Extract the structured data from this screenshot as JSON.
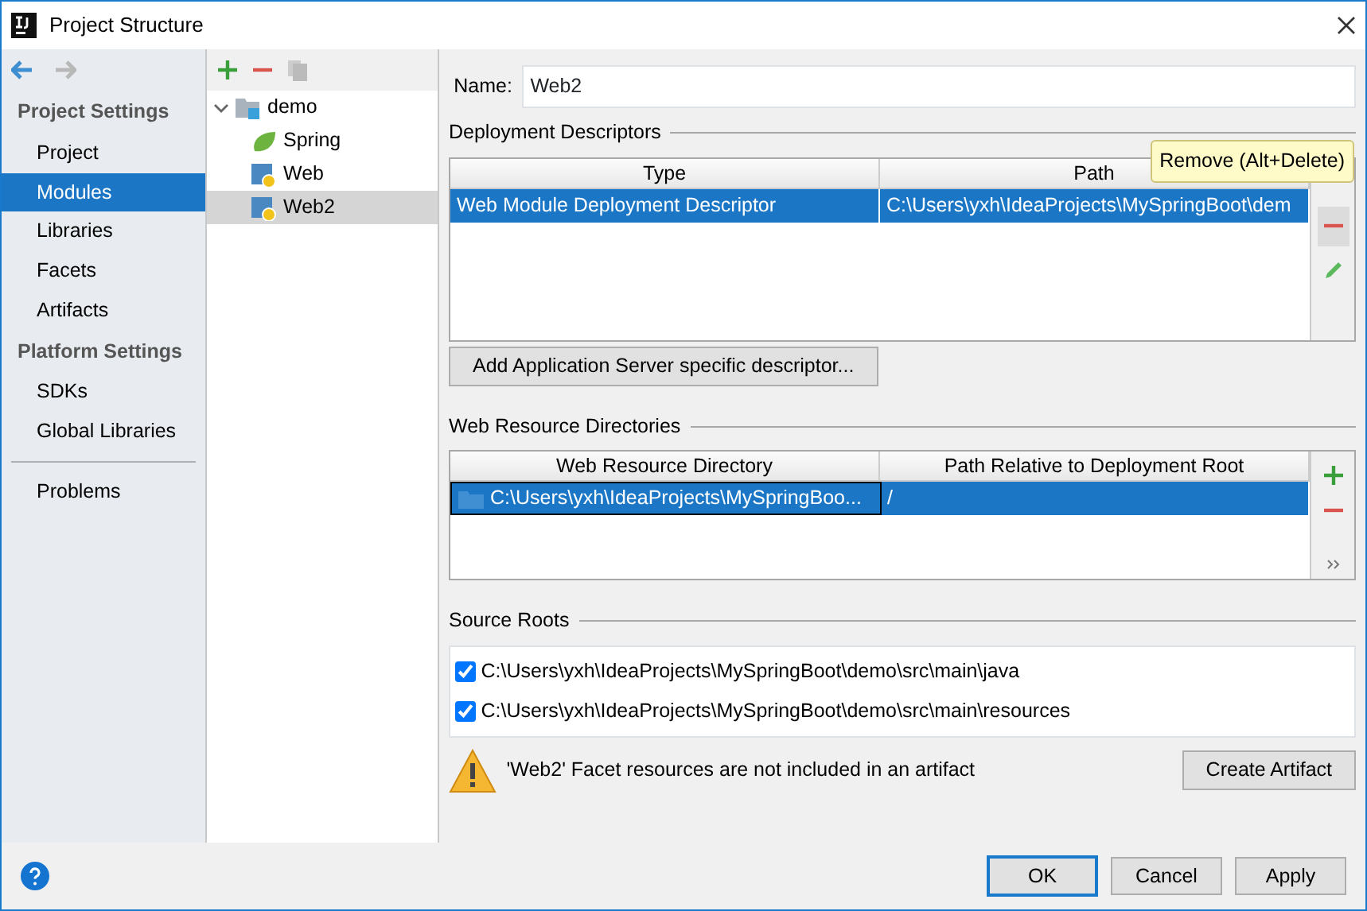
{
  "window": {
    "title": "Project Structure"
  },
  "sidebar": {
    "sections": [
      {
        "heading": "Project Settings",
        "items": [
          {
            "label": "Project",
            "selected": false
          },
          {
            "label": "Modules",
            "selected": true
          },
          {
            "label": "Libraries",
            "selected": false
          },
          {
            "label": "Facets",
            "selected": false
          },
          {
            "label": "Artifacts",
            "selected": false
          }
        ]
      },
      {
        "heading": "Platform Settings",
        "items": [
          {
            "label": "SDKs",
            "selected": false
          },
          {
            "label": "Global Libraries",
            "selected": false
          }
        ]
      }
    ],
    "bottom_items": [
      {
        "label": "Problems",
        "selected": false
      }
    ]
  },
  "tree": [
    {
      "label": "demo",
      "kind": "module",
      "expanded": true,
      "selected": false,
      "children": [
        {
          "label": "Spring",
          "kind": "spring",
          "selected": false
        },
        {
          "label": "Web",
          "kind": "web",
          "selected": false
        },
        {
          "label": "Web2",
          "kind": "web",
          "selected": true
        }
      ]
    }
  ],
  "name_field": {
    "label": "Name:",
    "value": "Web2"
  },
  "deployment_descriptors": {
    "title": "Deployment Descriptors",
    "columns": [
      "Type",
      "Path"
    ],
    "rows": [
      {
        "cells": [
          "Web Module Deployment Descriptor",
          "C:\\Users\\yxh\\IdeaProjects\\MySpringBoot\\dem"
        ],
        "selected": true
      }
    ],
    "tooltip": "Remove (Alt+Delete)",
    "add_button": "Add Application Server specific descriptor..."
  },
  "web_resource_directories": {
    "title": "Web Resource Directories",
    "columns": [
      "Web Resource Directory",
      "Path Relative to Deployment Root"
    ],
    "rows": [
      {
        "cells": [
          "C:\\Users\\yxh\\IdeaProjects\\MySpringBoo...",
          "/"
        ],
        "selected": true
      }
    ]
  },
  "source_roots": {
    "title": "Source Roots",
    "items": [
      {
        "label": "C:\\Users\\yxh\\IdeaProjects\\MySpringBoot\\demo\\src\\main\\java",
        "checked": true
      },
      {
        "label": "C:\\Users\\yxh\\IdeaProjects\\MySpringBoot\\demo\\src\\main\\resources",
        "checked": true
      }
    ]
  },
  "warning": {
    "text": "'Web2' Facet resources are not included in an artifact",
    "button": "Create Artifact"
  },
  "footer": {
    "buttons": [
      {
        "label": "OK",
        "default": true
      },
      {
        "label": "Cancel",
        "default": false
      },
      {
        "label": "Apply",
        "default": false
      }
    ]
  }
}
